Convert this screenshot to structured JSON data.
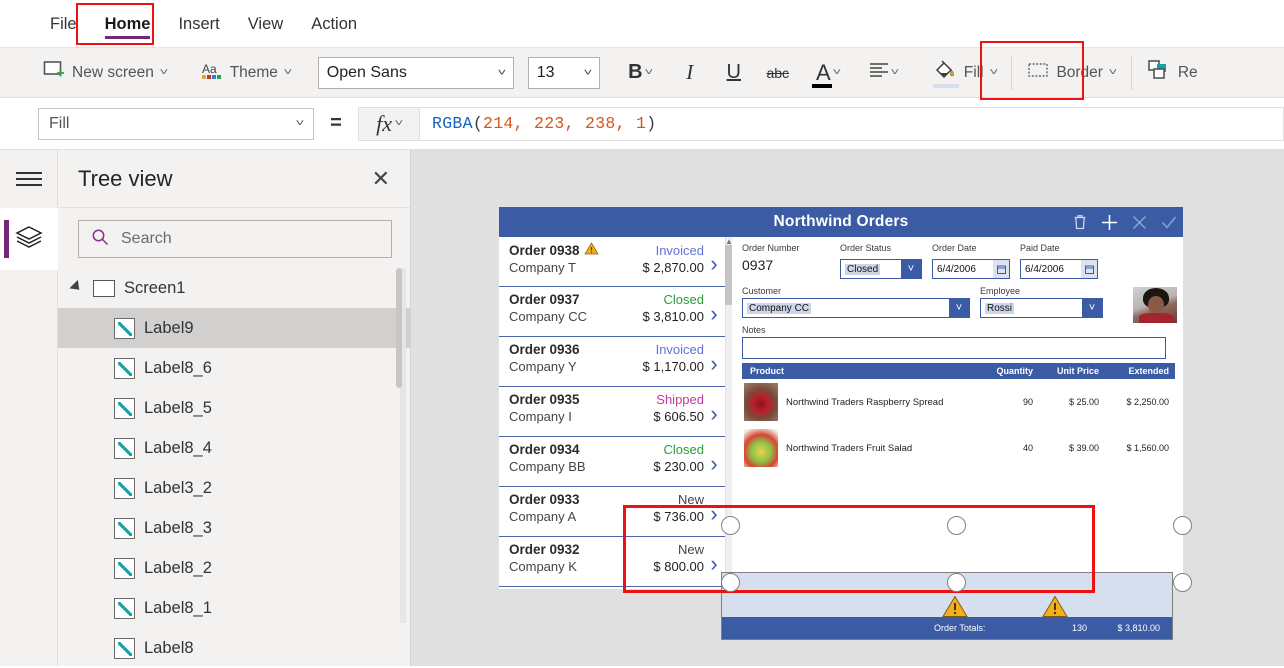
{
  "menu": {
    "items": [
      {
        "label": "File",
        "active": false
      },
      {
        "label": "Home",
        "active": true
      },
      {
        "label": "Insert",
        "active": false
      },
      {
        "label": "View",
        "active": false
      },
      {
        "label": "Action",
        "active": false
      }
    ]
  },
  "ribbon": {
    "new_screen": "New screen",
    "theme": "Theme",
    "font_family": "Open Sans",
    "font_size": "13",
    "bold": "B",
    "italic": "I",
    "underline": "U",
    "strikethrough": "abc",
    "font_color": "A",
    "align": "align-icon",
    "fill": "Fill",
    "border": "Border",
    "reorder": "Re",
    "font_color_swatch": "#000000",
    "fill_swatch": "#d6dfee",
    "highlight_color": "#ee1111"
  },
  "formula_bar": {
    "property": "Fill",
    "equals": "=",
    "fx": "fx",
    "formula_fn": "RGBA",
    "formula_open": "(",
    "formula_args": "214, 223, 238, 1",
    "formula_close": ")",
    "formula_full": "RGBA(214, 223, 238, 1)"
  },
  "treeview": {
    "title": "Tree view",
    "close": "✕",
    "search_placeholder": "Search",
    "search_value": "",
    "root": {
      "label": "Screen1",
      "expanded": true
    },
    "items": [
      {
        "label": "Label9",
        "selected": true
      },
      {
        "label": "Label8_6",
        "selected": false
      },
      {
        "label": "Label8_5",
        "selected": false
      },
      {
        "label": "Label8_4",
        "selected": false
      },
      {
        "label": "Label3_2",
        "selected": false
      },
      {
        "label": "Label8_3",
        "selected": false
      },
      {
        "label": "Label8_2",
        "selected": false
      },
      {
        "label": "Label8_1",
        "selected": false
      },
      {
        "label": "Label8",
        "selected": false
      }
    ]
  },
  "app": {
    "title": "Northwind Orders",
    "header_color": "#3b5ba5",
    "actions": [
      {
        "name": "delete-icon",
        "glyph": "🗑"
      },
      {
        "name": "add-icon",
        "glyph": "+"
      },
      {
        "name": "cancel-icon",
        "glyph": "✕"
      },
      {
        "name": "confirm-icon",
        "glyph": "✓"
      }
    ],
    "gallery": [
      {
        "order": "Order 0938",
        "company": "Company T",
        "status": "Invoiced",
        "amount": "$ 2,870.00",
        "warning": true
      },
      {
        "order": "Order 0937",
        "company": "Company CC",
        "status": "Closed",
        "amount": "$ 3,810.00",
        "warning": false
      },
      {
        "order": "Order 0936",
        "company": "Company Y",
        "status": "Invoiced",
        "amount": "$ 1,170.00",
        "warning": false
      },
      {
        "order": "Order 0935",
        "company": "Company I",
        "status": "Shipped",
        "amount": "$ 606.50",
        "warning": false
      },
      {
        "order": "Order 0934",
        "company": "Company BB",
        "status": "Closed",
        "amount": "$ 230.00",
        "warning": false
      },
      {
        "order": "Order 0933",
        "company": "Company A",
        "status": "New",
        "amount": "$ 736.00",
        "warning": false
      },
      {
        "order": "Order 0932",
        "company": "Company K",
        "status": "New",
        "amount": "$ 800.00",
        "warning": false
      }
    ],
    "detail": {
      "order_number_label": "Order Number",
      "order_number_value": "0937",
      "order_status_label": "Order Status",
      "order_status_value": "Closed",
      "order_date_label": "Order Date",
      "order_date_value": "6/4/2006",
      "paid_date_label": "Paid Date",
      "paid_date_value": "6/4/2006",
      "customer_label": "Customer",
      "customer_value": "Company CC",
      "employee_label": "Employee",
      "employee_value": "Rossi",
      "notes_label": "Notes",
      "notes_value": ""
    },
    "products": {
      "columns": [
        "Product",
        "Quantity",
        "Unit Price",
        "Extended"
      ],
      "rows": [
        {
          "product": "Northwind Traders Raspberry Spread",
          "quantity": "90",
          "unit_price": "$ 25.00",
          "extended": "$ 2,250.00"
        },
        {
          "product": "Northwind Traders Fruit Salad",
          "quantity": "40",
          "unit_price": "$ 39.00",
          "extended": "$ 1,560.00"
        }
      ]
    },
    "totals": {
      "label": "Order Totals:",
      "quantity": "130",
      "amount": "$ 3,810.00",
      "fill_color": "#d6dfee",
      "bar_color": "#3b5ba5"
    }
  }
}
